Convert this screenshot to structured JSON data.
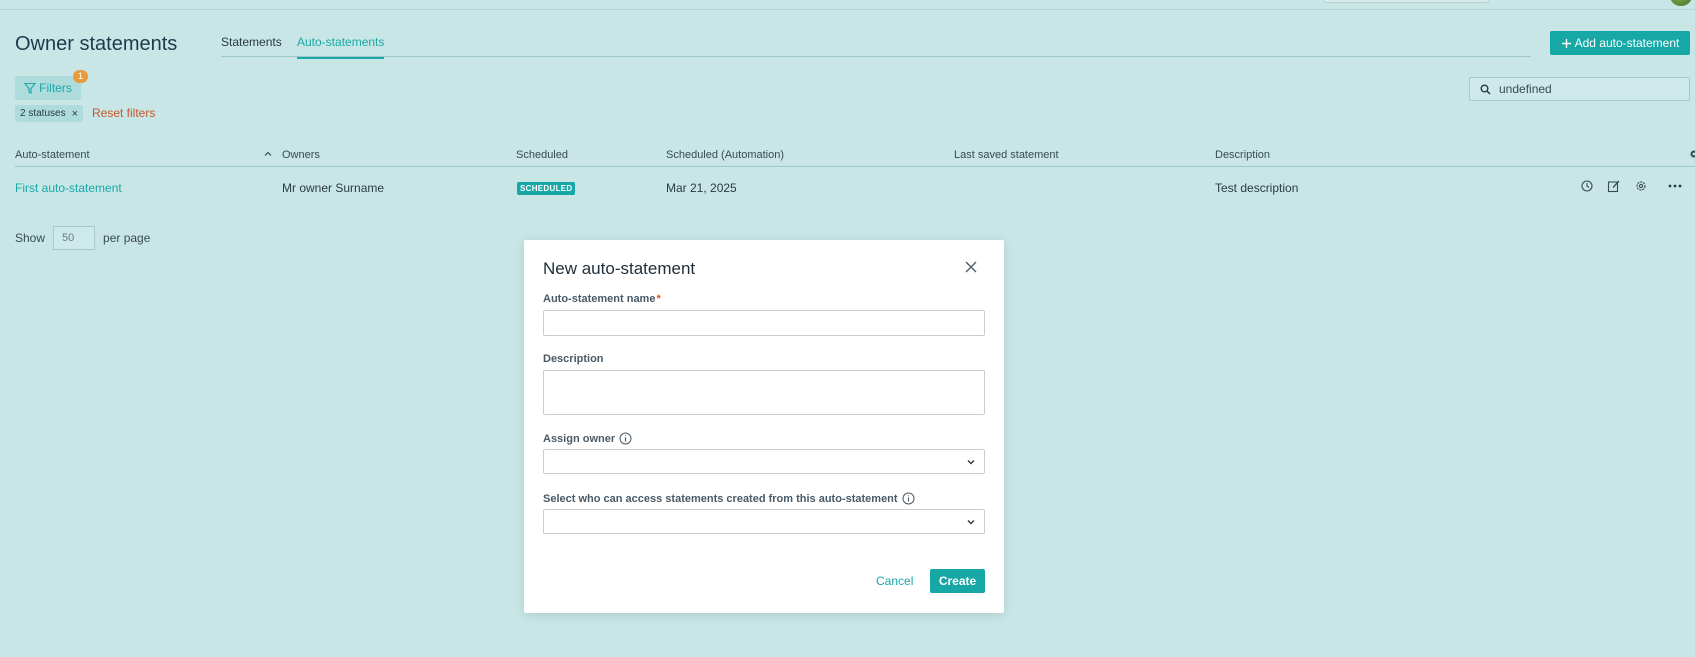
{
  "page": {
    "title": "Owner statements",
    "tabs": [
      {
        "label": "Statements",
        "active": false
      },
      {
        "label": "Auto-statements",
        "active": true
      }
    ],
    "add_button_label": "Add auto-statement",
    "search_value": "undefined"
  },
  "filters": {
    "label": "Filters",
    "count": "1",
    "chip_label": "2 statuses",
    "chip_remove": "×",
    "reset_label": "Reset filters"
  },
  "table": {
    "columns": [
      "Auto-statement",
      "Owners",
      "Scheduled",
      "Scheduled (Automation)",
      "Last saved statement",
      "Description"
    ],
    "rows": [
      {
        "name": "First auto-statement",
        "owners": "Mr owner Surname",
        "scheduled": "SCHEDULED",
        "scheduled_automation": "Mar 21, 2025",
        "last_saved": "",
        "description": "Test description"
      }
    ]
  },
  "pagination": {
    "show_label": "Show",
    "per_page_value": "50",
    "per_page_label": "per page"
  },
  "modal": {
    "title": "New auto-statement",
    "fields": {
      "name_label": "Auto-statement name",
      "name_required_mark": "*",
      "description_label": "Description",
      "owner_label": "Assign owner",
      "access_label": "Select who can access statements created from this auto-statement"
    },
    "cancel_label": "Cancel",
    "create_label": "Create"
  },
  "colors": {
    "background": "#c8e6e6",
    "accent": "#17a7a5",
    "reset_link": "#c6562a",
    "badge": "#e89a3c"
  }
}
